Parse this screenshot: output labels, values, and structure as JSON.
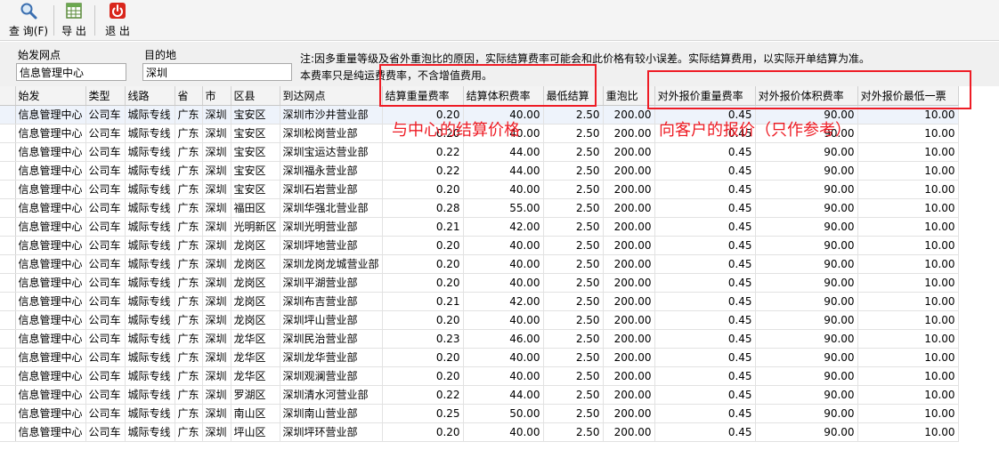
{
  "toolbar": {
    "query_label": "查 询(F)",
    "export_label": "导 出",
    "exit_label": "退  出"
  },
  "filter": {
    "origin_label": "始发网点",
    "origin_value": "信息管理中心",
    "dest_label": "目的地",
    "dest_value": "深圳",
    "note_line1": "注:因多重量等级及省外重泡比的原因，实际结算费率可能会和此价格有较小误差。实际结算费用，以实际开单结算为准。",
    "note_line2": "本费率只是纯运费费率，不含增值费用。"
  },
  "annotations": {
    "settlement": "与中心的结算价格",
    "customer": "向客户的报价（只作参考）",
    "color": "#ee1c25"
  },
  "table": {
    "columns": [
      "始发",
      "类型",
      "线路",
      "省",
      "市",
      "区县",
      "到达网点",
      "结算重量费率",
      "结算体积费率",
      "最低结算",
      "重泡比",
      "对外报价重量费率",
      "对外报价体积费率",
      "对外报价最低一票"
    ],
    "rows": [
      [
        "信息管理中心",
        "公司车",
        "城际专线",
        "广东",
        "深圳",
        "宝安区",
        "深圳市沙井营业部",
        "0.20",
        "40.00",
        "2.50",
        "200.00",
        "0.45",
        "90.00",
        "10.00"
      ],
      [
        "信息管理中心",
        "公司车",
        "城际专线",
        "广东",
        "深圳",
        "宝安区",
        "深圳松岗营业部",
        "0.20",
        "40.00",
        "2.50",
        "200.00",
        "0.45",
        "90.00",
        "10.00"
      ],
      [
        "信息管理中心",
        "公司车",
        "城际专线",
        "广东",
        "深圳",
        "宝安区",
        "深圳宝运达营业部",
        "0.22",
        "44.00",
        "2.50",
        "200.00",
        "0.45",
        "90.00",
        "10.00"
      ],
      [
        "信息管理中心",
        "公司车",
        "城际专线",
        "广东",
        "深圳",
        "宝安区",
        "深圳福永营业部",
        "0.22",
        "44.00",
        "2.50",
        "200.00",
        "0.45",
        "90.00",
        "10.00"
      ],
      [
        "信息管理中心",
        "公司车",
        "城际专线",
        "广东",
        "深圳",
        "宝安区",
        "深圳石岩营业部",
        "0.20",
        "40.00",
        "2.50",
        "200.00",
        "0.45",
        "90.00",
        "10.00"
      ],
      [
        "信息管理中心",
        "公司车",
        "城际专线",
        "广东",
        "深圳",
        "福田区",
        "深圳华强北营业部",
        "0.28",
        "55.00",
        "2.50",
        "200.00",
        "0.45",
        "90.00",
        "10.00"
      ],
      [
        "信息管理中心",
        "公司车",
        "城际专线",
        "广东",
        "深圳",
        "光明新区",
        "深圳光明营业部",
        "0.21",
        "42.00",
        "2.50",
        "200.00",
        "0.45",
        "90.00",
        "10.00"
      ],
      [
        "信息管理中心",
        "公司车",
        "城际专线",
        "广东",
        "深圳",
        "龙岗区",
        "深圳坪地营业部",
        "0.20",
        "40.00",
        "2.50",
        "200.00",
        "0.45",
        "90.00",
        "10.00"
      ],
      [
        "信息管理中心",
        "公司车",
        "城际专线",
        "广东",
        "深圳",
        "龙岗区",
        "深圳龙岗龙城营业部",
        "0.20",
        "40.00",
        "2.50",
        "200.00",
        "0.45",
        "90.00",
        "10.00"
      ],
      [
        "信息管理中心",
        "公司车",
        "城际专线",
        "广东",
        "深圳",
        "龙岗区",
        "深圳平湖营业部",
        "0.20",
        "40.00",
        "2.50",
        "200.00",
        "0.45",
        "90.00",
        "10.00"
      ],
      [
        "信息管理中心",
        "公司车",
        "城际专线",
        "广东",
        "深圳",
        "龙岗区",
        "深圳布吉营业部",
        "0.21",
        "42.00",
        "2.50",
        "200.00",
        "0.45",
        "90.00",
        "10.00"
      ],
      [
        "信息管理中心",
        "公司车",
        "城际专线",
        "广东",
        "深圳",
        "龙岗区",
        "深圳坪山营业部",
        "0.20",
        "40.00",
        "2.50",
        "200.00",
        "0.45",
        "90.00",
        "10.00"
      ],
      [
        "信息管理中心",
        "公司车",
        "城际专线",
        "广东",
        "深圳",
        "龙华区",
        "深圳民治营业部",
        "0.23",
        "46.00",
        "2.50",
        "200.00",
        "0.45",
        "90.00",
        "10.00"
      ],
      [
        "信息管理中心",
        "公司车",
        "城际专线",
        "广东",
        "深圳",
        "龙华区",
        "深圳龙华营业部",
        "0.20",
        "40.00",
        "2.50",
        "200.00",
        "0.45",
        "90.00",
        "10.00"
      ],
      [
        "信息管理中心",
        "公司车",
        "城际专线",
        "广东",
        "深圳",
        "龙华区",
        "深圳观澜营业部",
        "0.20",
        "40.00",
        "2.50",
        "200.00",
        "0.45",
        "90.00",
        "10.00"
      ],
      [
        "信息管理中心",
        "公司车",
        "城际专线",
        "广东",
        "深圳",
        "罗湖区",
        "深圳清水河营业部",
        "0.22",
        "44.00",
        "2.50",
        "200.00",
        "0.45",
        "90.00",
        "10.00"
      ],
      [
        "信息管理中心",
        "公司车",
        "城际专线",
        "广东",
        "深圳",
        "南山区",
        "深圳南山营业部",
        "0.25",
        "50.00",
        "2.50",
        "200.00",
        "0.45",
        "90.00",
        "10.00"
      ],
      [
        "信息管理中心",
        "公司车",
        "城际专线",
        "广东",
        "深圳",
        "坪山区",
        "深圳坪环营业部",
        "0.20",
        "40.00",
        "2.50",
        "200.00",
        "0.45",
        "90.00",
        "10.00"
      ]
    ]
  }
}
